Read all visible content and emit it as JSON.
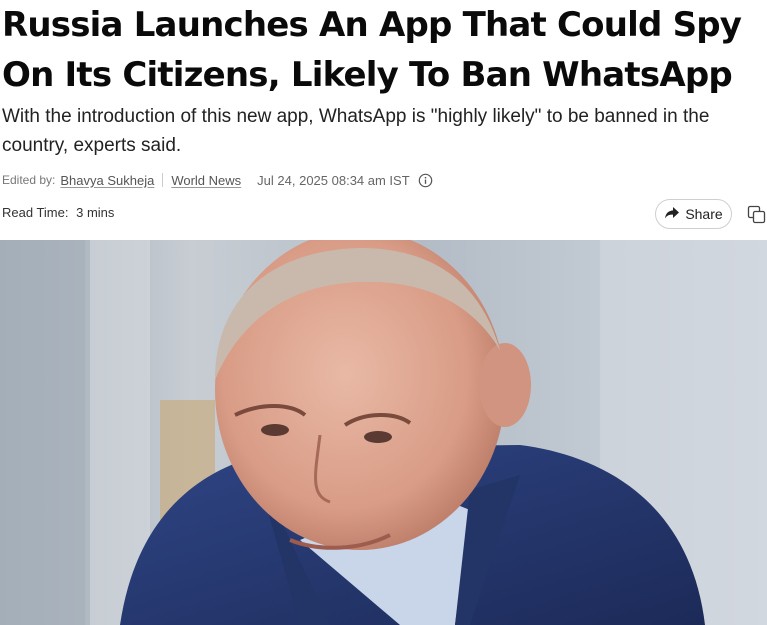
{
  "article": {
    "headline_line1": "Russia Launches An App That Could Spy",
    "headline_line2": "On Its Citizens, Likely To Ban WhatsApp",
    "subheadline": "With the introduction of this new app, WhatsApp is \"highly likely\" to be banned in the country, experts said.",
    "edited_by_label": "Edited by:",
    "author": "Bhavya Sukheja",
    "category": "World News",
    "date": "Jul 24, 2025 08:34 am IST",
    "read_time_label": "Read Time:",
    "read_time_value": "3 mins"
  },
  "actions": {
    "share_label": "Share",
    "share_icon": "share-arrow-icon",
    "copy_icon": "copy-icon",
    "info_icon": "info-icon"
  },
  "hero_image": {
    "subject": "portrait-photo",
    "colors": {
      "suit": "#2a3d78",
      "shirt": "#c9d6ea",
      "background": "#b9c2cc"
    }
  }
}
